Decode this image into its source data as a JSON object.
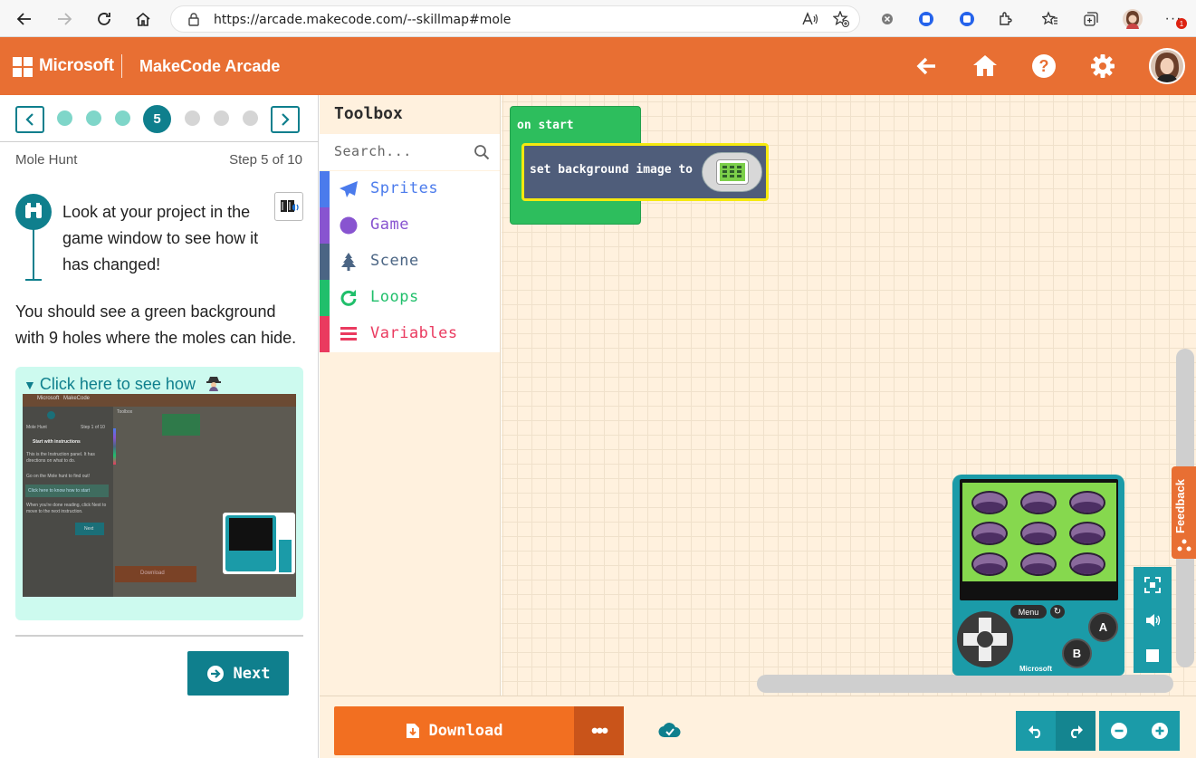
{
  "browser": {
    "url": "https://arcade.makecode.com/--skillmap#mole",
    "notification_count": "1"
  },
  "header": {
    "brand": "Microsoft",
    "product": "MakeCode Arcade",
    "accent_color": "#e86f33"
  },
  "tutorial": {
    "current_step": "5",
    "title": "Mole Hunt",
    "step_label": "Step 5 of 10",
    "heading": "Look at your project in the game window to see how it has changed!",
    "body": "You should see a green background with 9 holes where the moles can hide.",
    "hint_summary": "Click here to see how",
    "next_label": "Next",
    "accent_color": "#0f7f8d"
  },
  "hint_preview": {
    "brand": "Microsoft",
    "product": "MakeCode",
    "title": "Mole Hunt",
    "step": "Step 1 of 10",
    "heading": "Start with instructions",
    "text1": "This is the Instruction panel. It has directions on what to do.",
    "text2": "Go on the Mole hunt to find out!",
    "hint": "Click here to know how to start",
    "text3": "When you're done reading, click Next to move to the next instruction.",
    "next": "Next",
    "toolbox": "Toolbox",
    "download": "Download"
  },
  "toolbox": {
    "title": "Toolbox",
    "search_placeholder": "Search...",
    "categories": [
      {
        "label": "Sprites",
        "color": "#4b7bec"
      },
      {
        "label": "Game",
        "color": "#8854d0"
      },
      {
        "label": "Scene",
        "color": "#4b6584"
      },
      {
        "label": "Loops",
        "color": "#20bf6b"
      },
      {
        "label": "Variables",
        "color": "#ea3a5f"
      }
    ]
  },
  "workspace": {
    "on_start_label": "on start",
    "set_bg_label": "set background image to"
  },
  "simulator": {
    "menu_label": "Menu",
    "a_label": "A",
    "b_label": "B",
    "brand": "Microsoft",
    "moles": 9
  },
  "feedback_label": "Feedback",
  "bottombar": {
    "download_label": "Download",
    "more_label": "•••"
  }
}
